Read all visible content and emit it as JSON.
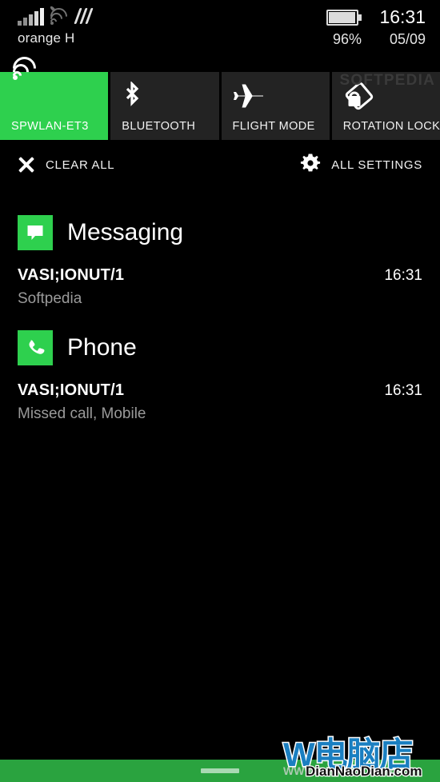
{
  "status_bar": {
    "carrier": "orange H",
    "signal_icon": "signal-bars-icon",
    "wifi_icon": "wifi-unavailable-icon",
    "vibrate_icon": "vibrate-icon",
    "battery_icon": "battery-icon",
    "battery_percent": "96%",
    "time": "16:31",
    "date": "05/09"
  },
  "quick_actions": [
    {
      "label": "SPWLAN-ET3",
      "icon": "wifi-icon",
      "active": true
    },
    {
      "label": "BLUETOOTH",
      "icon": "bluetooth-icon",
      "active": false
    },
    {
      "label": "FLIGHT MODE",
      "icon": "airplane-icon",
      "active": false
    },
    {
      "label": "ROTATION LOCK",
      "icon": "rotation-lock-icon",
      "active": false
    }
  ],
  "action_row": {
    "clear_all": "CLEAR ALL",
    "clear_all_icon": "close-x-icon",
    "all_settings": "ALL SETTINGS",
    "all_settings_icon": "gear-icon"
  },
  "notification_groups": [
    {
      "app": "Messaging",
      "app_icon": "message-bubble-icon",
      "items": [
        {
          "title": "VASI;IONUT/1",
          "body": "Softpedia",
          "time": "16:31"
        }
      ]
    },
    {
      "app": "Phone",
      "app_icon": "phone-handset-icon",
      "items": [
        {
          "title": "VASI;IONUT/1",
          "body": "Missed call, Mobile",
          "time": "16:31"
        }
      ]
    }
  ],
  "watermarks": {
    "softpedia": "SOFTPEDIA",
    "site_logo": "W电脑店",
    "site_domain": "DianNaoDian.com",
    "site_ghost": "WWW.DianNaoDian.com"
  },
  "nav_bar": {
    "home_indicator": "home-indicator"
  },
  "colors": {
    "accent_green": "#2ed04e",
    "nav_green": "#2aa33f",
    "tile_dark": "#232323",
    "background": "#000000",
    "secondary_text": "#9a9a9a"
  }
}
